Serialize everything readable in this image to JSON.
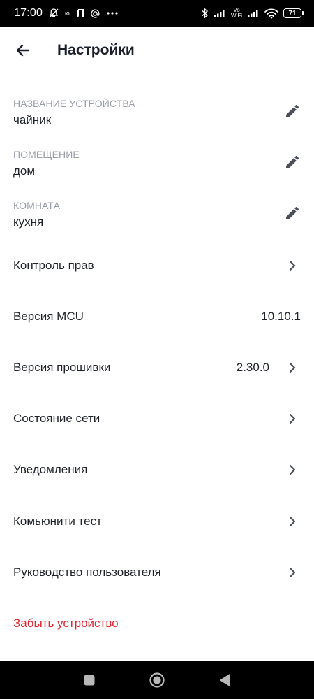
{
  "status_bar": {
    "time": "17:00",
    "left_icons": [
      "bell-off-icon",
      "notification-icon",
      "app-icon",
      "at-sign-icon",
      "more-dots-icon"
    ],
    "volte_top": "Vo",
    "volte_bottom": "WiFi",
    "battery": "71"
  },
  "header": {
    "title": "Настройки"
  },
  "fields": [
    {
      "label": "НАЗВАНИЕ УСТРОЙСТВА",
      "value": "чайник"
    },
    {
      "label": "ПОМЕЩЕНИЕ",
      "value": "дом"
    },
    {
      "label": "КОМНАТА",
      "value": "кухня"
    }
  ],
  "menu": [
    {
      "label": "Контроль прав"
    },
    {
      "label": "Версия MCU",
      "value": "10.10.1"
    },
    {
      "label": "Версия прошивки",
      "value": "2.30.0"
    },
    {
      "label": "Состояние сети"
    },
    {
      "label": "Уведомления"
    },
    {
      "label": "Комьюнити тест"
    },
    {
      "label": "Руководство пользователя"
    },
    {
      "label": "Забыть устройство"
    }
  ],
  "colors": {
    "danger": "#e0262f",
    "label_gray": "#9a9ea6",
    "text": "#1f2329",
    "icon": "#4a4f5a"
  }
}
